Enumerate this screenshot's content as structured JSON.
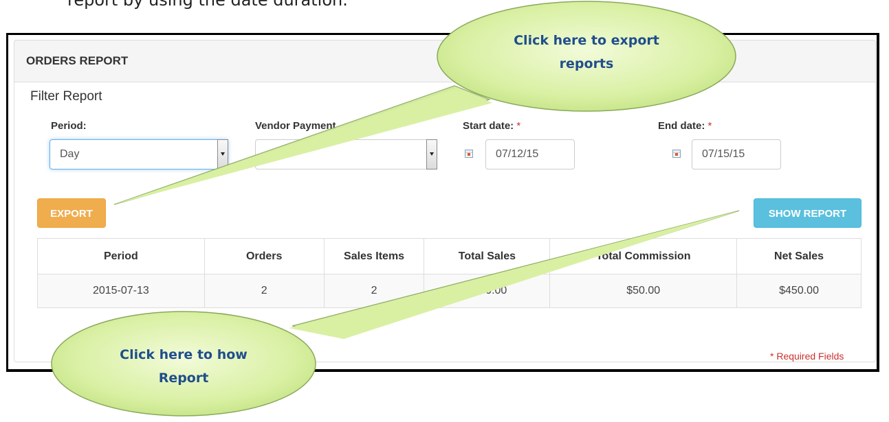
{
  "doc": {
    "caption": "report by using the date duration."
  },
  "panel": {
    "title": "ORDERS REPORT",
    "filter_title": "Filter Report"
  },
  "filters": {
    "period": {
      "label": "Period:",
      "value": "Day"
    },
    "vendor_payment": {
      "label": "Vendor Payment",
      "value": ""
    },
    "start_date": {
      "label": "Start date:",
      "required_mark": "*",
      "value": "07/12/15"
    },
    "end_date": {
      "label": "End date:",
      "required_mark": "*",
      "value": "07/15/15"
    }
  },
  "buttons": {
    "export": "EXPORT",
    "show_report": "SHOW REPORT"
  },
  "table": {
    "headers": [
      "Period",
      "Orders",
      "Sales Items",
      "Total Sales",
      "Total Commission",
      "Net Sales"
    ],
    "rows": [
      [
        "2015-07-13",
        "2",
        "2",
        "$500.00",
        "$50.00",
        "$450.00"
      ]
    ]
  },
  "required_note": "* Required Fields",
  "callouts": {
    "export": {
      "line1": "Click here to export",
      "line2": "reports"
    },
    "show": {
      "line1": "Click here to how",
      "line2": "Report"
    }
  },
  "colors": {
    "export_button": "#f0ad4e",
    "show_button": "#5bc0de",
    "required": "#c9302c",
    "callout_fill": "#d9f0a3",
    "callout_text": "#1f4e8c"
  },
  "icons": {
    "calendar": "calendar-icon",
    "dropdown": "chevron-down-icon"
  }
}
